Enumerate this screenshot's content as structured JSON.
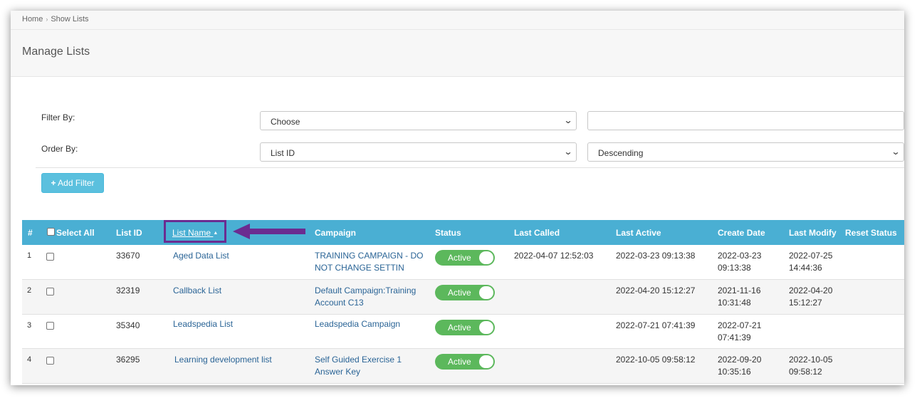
{
  "breadcrumb": {
    "home": "Home",
    "separator": "›",
    "current": "Show Lists"
  },
  "page_title": "Manage Lists",
  "filters": {
    "filter_by_label": "Filter By:",
    "filter_by_value": "Choose",
    "filter_text_value": "",
    "order_by_label": "Order By:",
    "order_by_value": "List ID",
    "order_dir_value": "Descending",
    "chevron_icon": "chevron-down-icon"
  },
  "add_filter": {
    "icon": "plus-icon",
    "plus": "+",
    "label": "Add Filter"
  },
  "table": {
    "headers": {
      "num": "#",
      "select_all": "Select All",
      "list_id": "List ID",
      "list_name": "List Name",
      "sort_indicator": "▲",
      "campaign": "Campaign",
      "status": "Status",
      "last_called": "Last Called",
      "last_active": "Last Active",
      "create_date": "Create Date",
      "last_modify": "Last Modify",
      "reset_status": "Reset Status"
    },
    "rows": [
      {
        "num": "1",
        "list_id": "33670",
        "list_name": "Aged Data List",
        "campaign_line1": "TRAINING CAMPAIGN - DO",
        "campaign_line2": "NOT CHANGE SETTIN",
        "status": "Active",
        "last_called": "2022-04-07 12:52:03",
        "last_active": "2022-03-23 09:13:38",
        "create_date_line1": "2022-03-23",
        "create_date_line2": "09:13:38",
        "last_modify_line1": "2022-07-25",
        "last_modify_line2": "14:44:36"
      },
      {
        "num": "2",
        "list_id": "32319",
        "list_name": "Callback List",
        "campaign_line1": "Default Campaign:Training",
        "campaign_line2": "Account C13",
        "status": "Active",
        "last_called": "",
        "last_active": "2022-04-20 15:12:27",
        "create_date_line1": "2021-11-16",
        "create_date_line2": "10:31:48",
        "last_modify_line1": "2022-04-20",
        "last_modify_line2": "15:12:27"
      },
      {
        "num": "3",
        "list_id": "35340",
        "list_name": "Leadspedia List",
        "campaign_line1": "Leadspedia Campaign",
        "campaign_line2": "",
        "status": "Active",
        "last_called": "",
        "last_active": "2022-07-21 07:41:39",
        "create_date_line1": "2022-07-21",
        "create_date_line2": "07:41:39",
        "last_modify_line1": "",
        "last_modify_line2": ""
      },
      {
        "num": "4",
        "list_id": "36295",
        "list_name": "Learning development list",
        "campaign_line1": "Self Guided Exercise 1",
        "campaign_line2": "Answer Key",
        "status": "Active",
        "last_called": "",
        "last_active": "2022-10-05 09:58:12",
        "create_date_line1": "2022-09-20",
        "create_date_line2": "10:35:16",
        "last_modify_line1": "2022-10-05",
        "last_modify_line2": "09:58:12"
      }
    ]
  },
  "annotation": {
    "highlight_color": "#6b2c91",
    "arrow_icon": "left-arrow-icon"
  },
  "colors": {
    "header_bg": "#4aafd3",
    "toggle_on": "#5cb85c",
    "button_bg": "#5bc0de",
    "link": "#2a6496"
  }
}
